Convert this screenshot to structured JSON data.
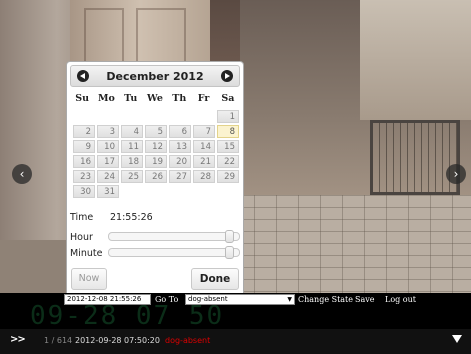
{
  "navigation": {
    "prev_icon": "chevron-left-icon",
    "next_icon": "chevron-right-icon",
    "prev_glyph": "‹",
    "next_glyph": "›"
  },
  "datepicker": {
    "month_title": "December 2012",
    "prev_icon": "circle-arrow-left-icon",
    "next_icon": "circle-arrow-right-icon",
    "weekdays": [
      "Su",
      "Mo",
      "Tu",
      "We",
      "Th",
      "Fr",
      "Sa"
    ],
    "leading_blanks": 6,
    "days": [
      "1",
      "2",
      "3",
      "4",
      "5",
      "6",
      "7",
      "8",
      "9",
      "10",
      "11",
      "12",
      "13",
      "14",
      "15",
      "16",
      "17",
      "18",
      "19",
      "20",
      "21",
      "22",
      "23",
      "24",
      "25",
      "26",
      "27",
      "28",
      "29",
      "30",
      "31"
    ],
    "highlighted_day": "8",
    "time_label": "Time",
    "time_value": "21:55:26",
    "hour_label": "Hour",
    "minute_label": "Minute",
    "hour_level": 0.96,
    "minute_level": 0.96,
    "now_label": "Now",
    "done_label": "Done"
  },
  "controls": {
    "watermark": "09-28 07 50",
    "datetime_value": "2012-12-08 21:55:26",
    "goto_label": "Go To",
    "state_value": "dog-absent",
    "change_state_label": "Change State",
    "save_label": "Save",
    "logout_label": "Log out"
  },
  "status_bar": {
    "fast_forward": ">>",
    "counter": "1 / 614",
    "timestamp": "2012-09-28 07:50:20",
    "state": "dog-absent",
    "state_color": "#dd0000",
    "menu_icon": "triangle-down-icon"
  },
  "colors": {
    "today_highlight": "#fbf3cf",
    "bar_background": "#000000"
  }
}
